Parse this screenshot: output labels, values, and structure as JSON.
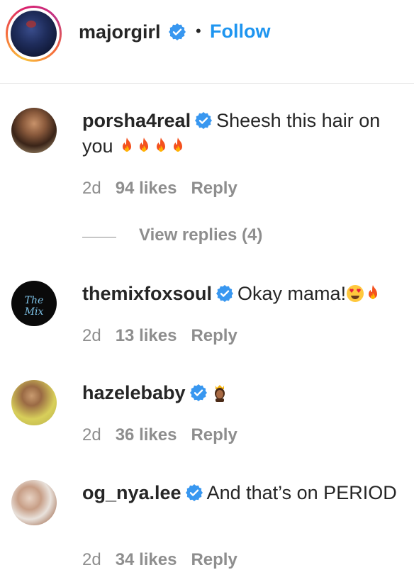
{
  "header": {
    "username": "majorgirl",
    "separator": "•",
    "follow_label": "Follow"
  },
  "comments": [
    {
      "username": "porsha4real",
      "text": "Sheesh this hair on you",
      "emojis": [
        "fire-icon",
        "fire-icon",
        "fire-icon",
        "fire-icon"
      ],
      "time": "2d",
      "likes": "94 likes",
      "reply": "Reply",
      "view_replies": "View replies (4)"
    },
    {
      "username": "themixfoxsoul",
      "avatar_text": "The Mix",
      "text": "Okay mama!",
      "emojis": [
        "heart-eyes-icon",
        "fire-icon"
      ],
      "time": "2d",
      "likes": "13 likes",
      "reply": "Reply"
    },
    {
      "username": "hazelebaby",
      "text": "",
      "emojis": [
        "princess-icon"
      ],
      "time": "2d",
      "likes": "36 likes",
      "reply": "Reply"
    },
    {
      "username": "og_nya.lee",
      "text": "And that’s on PERIOD",
      "time": "2d",
      "likes": "34 likes",
      "reply": "Reply"
    }
  ],
  "colors": {
    "accent": "#1e95f0",
    "verified": "#3897f0",
    "text": "#262626",
    "muted": "#8e8e8e",
    "divider": "#e6e6e6"
  }
}
